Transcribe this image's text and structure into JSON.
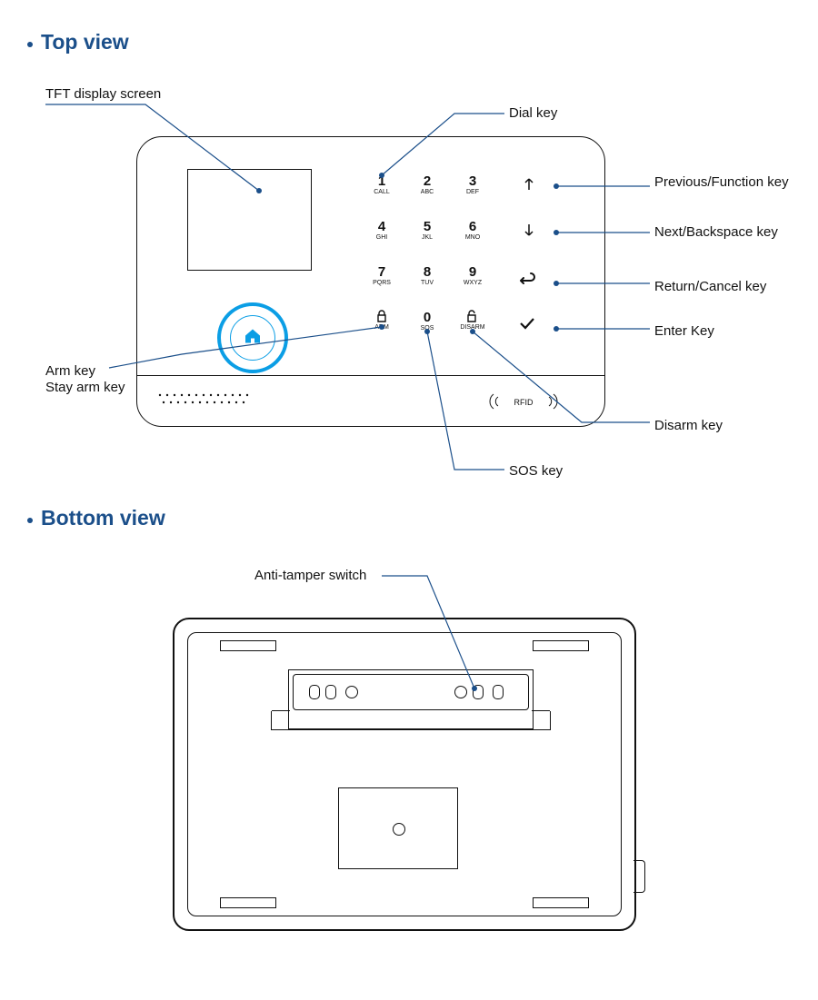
{
  "sections": {
    "top_title": "Top view",
    "bottom_title": "Bottom view"
  },
  "top_labels": {
    "tft": "TFT display screen",
    "dial": "Dial key",
    "prev": "Previous/Function key",
    "next": "Next/Backspace key",
    "return": "Return/Cancel key",
    "enter": "Enter Key",
    "disarm": "Disarm key",
    "sos": "SOS key",
    "arm": "Arm key",
    "stay": "Stay arm key"
  },
  "keys": {
    "k1": {
      "num": "1",
      "sub": "CALL"
    },
    "k2": {
      "num": "2",
      "sub": "ABC"
    },
    "k3": {
      "num": "3",
      "sub": "DEF"
    },
    "k4": {
      "num": "4",
      "sub": "GHI"
    },
    "k5": {
      "num": "5",
      "sub": "JKL"
    },
    "k6": {
      "num": "6",
      "sub": "MNO"
    },
    "k7": {
      "num": "7",
      "sub": "PQRS"
    },
    "k8": {
      "num": "8",
      "sub": "TUV"
    },
    "k9": {
      "num": "9",
      "sub": "WXYZ"
    },
    "karm": {
      "sub": "ARM"
    },
    "k0": {
      "num": "0",
      "sub": "SOS"
    },
    "kdis": {
      "sub": "DISARM"
    }
  },
  "rfid_label": "RFID",
  "bottom_labels": {
    "tamper": "Anti-tamper switch"
  },
  "colors": {
    "accent": "#1b4f8a",
    "bright": "#0b9ee5"
  }
}
